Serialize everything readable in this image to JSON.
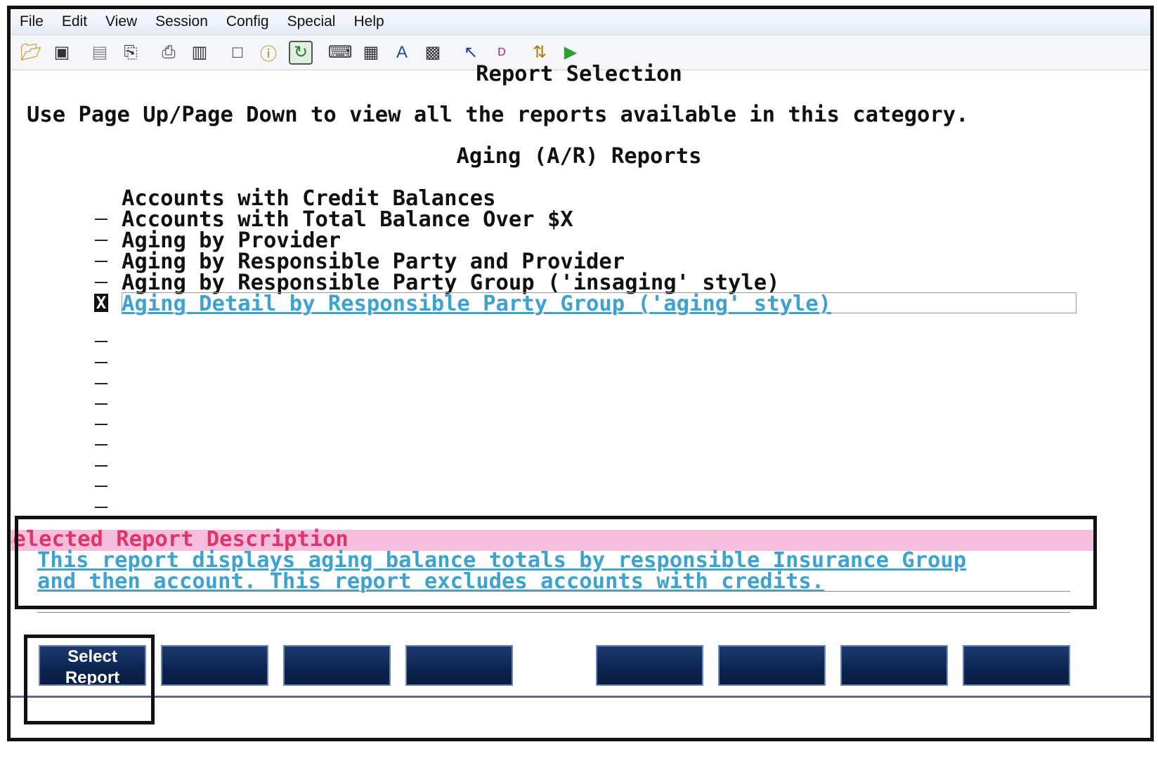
{
  "menubar": {
    "items": [
      "File",
      "Edit",
      "View",
      "Session",
      "Config",
      "Special",
      "Help"
    ]
  },
  "toolbar": {
    "icons": [
      "open-folder-icon",
      "save-icon",
      "copy-icon",
      "paste-icon",
      "print-icon",
      "print-screen-icon",
      "window-icon",
      "info-icon",
      "refresh-icon",
      "keyboard-icon",
      "form-icon",
      "font-icon",
      "grid-icon",
      "help-pointer-icon",
      "dos-icon",
      "transfer-icon",
      "play-icon"
    ]
  },
  "screen": {
    "title": "Report Selection",
    "instructions": "Use Page Up/Page Down to view all the reports available in this category.",
    "category": "Aging (A/R) Reports",
    "reports": [
      "Accounts with Credit Balances",
      "Accounts with Total Balance Over $X",
      "Aging by Provider",
      "Aging by Responsible Party and Provider",
      "Aging by Responsible Party Group ('insaging' style)",
      "Aging Detail by Responsible Party Group ('aging' style)"
    ],
    "selected_marker": "X"
  },
  "description": {
    "header": "Selected Report Description",
    "line1": "This report displays aging balance totals by responsible Insurance Group",
    "line2": "and then account. This report excludes accounts with credits."
  },
  "function_keys": {
    "f1_label_line1": "Select",
    "f1_label_line2": "Report"
  }
}
